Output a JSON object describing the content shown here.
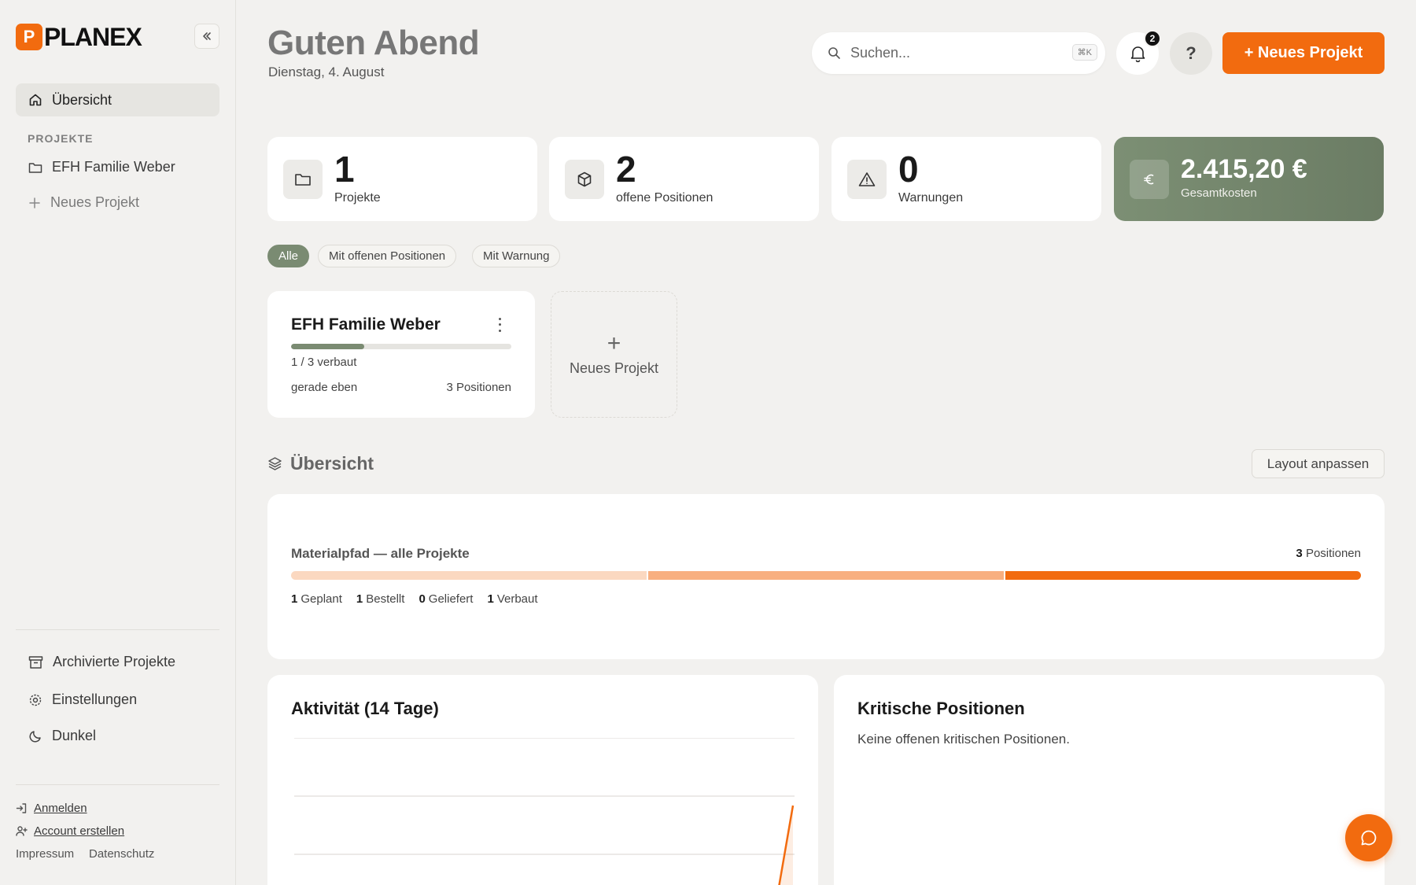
{
  "app": {
    "logo_letter": "P",
    "logo_text": "PLANEX"
  },
  "sidebar": {
    "nav_overview": "Übersicht",
    "section_projects": "PROJEKTE",
    "project_item": "EFH Familie Weber",
    "new_project": "Neues Projekt",
    "archived": "Archivierte Projekte",
    "settings": "Einstellungen",
    "theme": "Dunkel",
    "login": "Anmelden",
    "signup": "Account erstellen",
    "imprint": "Impressum",
    "privacy": "Datenschutz"
  },
  "header": {
    "greeting": "Guten Abend",
    "date": "Dienstag, 4. August",
    "search_placeholder": "Suchen...",
    "search_shortcut": "⌘K",
    "notification_count": "2",
    "help_label": "?",
    "new_project_button": "+ Neues Projekt"
  },
  "stats": [
    {
      "value": "1",
      "label": "Projekte",
      "icon": "folder-icon"
    },
    {
      "value": "2",
      "label": "offene Positionen",
      "icon": "box-icon"
    },
    {
      "value": "0",
      "label": "Warnungen",
      "icon": "warning-icon"
    },
    {
      "value": "2.415,20 €",
      "label": "Gesamtkosten",
      "icon": "euro-icon"
    }
  ],
  "filters": [
    "Alle",
    "Mit offenen Positionen",
    "Mit Warnung"
  ],
  "project_card": {
    "title": "EFH Familie Weber",
    "progress": 0.3333,
    "built_text": "1 / 3 verbaut",
    "updated": "gerade eben",
    "positions": "3 Positionen"
  },
  "new_project_tile": {
    "plus": "+",
    "label": "Neues Projekt"
  },
  "overview": {
    "title": "Übersicht",
    "layout_button": "Layout anpassen",
    "material": {
      "title": "Materialpfad — alle Projekte",
      "count_value": "3",
      "count_label": "Positionen",
      "segments": [
        {
          "label": "Geplant",
          "value": "1",
          "color": "#fbd8c0"
        },
        {
          "label": "Bestellt",
          "value": "1",
          "color": "#f8af80"
        },
        {
          "label": "Geliefert",
          "value": "0",
          "color": "#f59b60"
        },
        {
          "label": "Verbaut",
          "value": "1",
          "color": "#f26b0f"
        }
      ]
    }
  },
  "activity": {
    "title": "Aktivität (14 Tage)"
  },
  "critical": {
    "title": "Kritische Positionen",
    "empty": "Keine offenen kritischen Positionen."
  },
  "colors": {
    "accent": "#f26b0f",
    "sage": "#7a8b72",
    "background": "#f2f1ef"
  }
}
